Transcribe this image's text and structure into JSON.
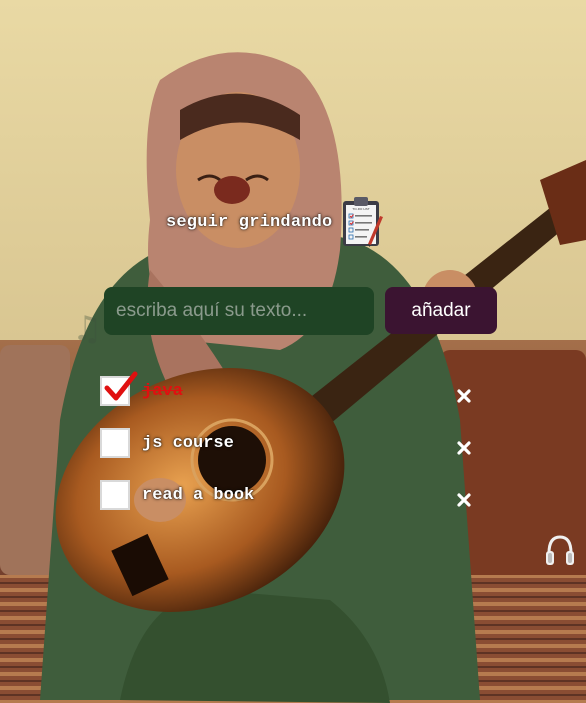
{
  "header": {
    "title": "seguir grindando",
    "icon": "clipboard-checklist-icon",
    "icon_caption": "TO-DO LIST"
  },
  "input": {
    "placeholder": "escriba aquí su texto...",
    "value": ""
  },
  "add_button": {
    "label": "añadar"
  },
  "tasks": [
    {
      "text": "java",
      "checked": true
    },
    {
      "text": "js course",
      "checked": false
    },
    {
      "text": "read a book",
      "checked": false
    }
  ],
  "icons": {
    "delete": "close-x-icon",
    "music": "headphones-icon",
    "background_note": "music-note-icon"
  },
  "colors": {
    "input_bg": "#1f4425",
    "button_bg": "#3b1431",
    "done_text": "#e01010",
    "checkmark": "#e01010",
    "text": "#ffffff"
  }
}
